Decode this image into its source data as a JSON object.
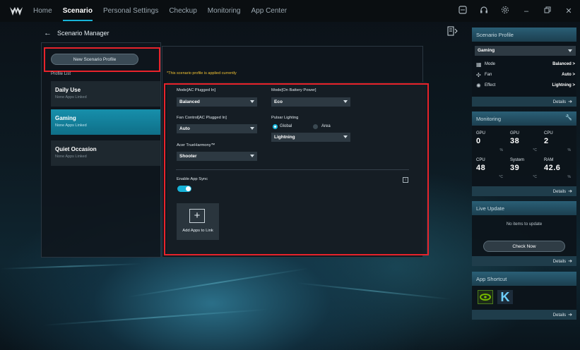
{
  "topbar": {
    "tabs": [
      {
        "label": "Home",
        "active": false
      },
      {
        "label": "Scenario",
        "active": true
      },
      {
        "label": "Personal Settings",
        "active": false
      },
      {
        "label": "Checkup",
        "active": false
      },
      {
        "label": "Monitoring",
        "active": false
      },
      {
        "label": "App Center",
        "active": false
      }
    ],
    "icons": [
      "screenshot-icon",
      "headset-icon",
      "settings-gear-icon",
      "minimize-icon",
      "restore-icon",
      "close-icon"
    ]
  },
  "header": {
    "title": "Scenario Manager"
  },
  "left": {
    "new_button": "New Scenario Profile",
    "list_label": "Profile List",
    "profiles": [
      {
        "name": "Daily Use",
        "sub": "None Apps Linked"
      },
      {
        "name": "Gaming",
        "sub": "None Apps Linked"
      },
      {
        "name": "Quiet Occasion",
        "sub": "None Apps Linked"
      }
    ]
  },
  "main": {
    "applied_note": "*This scenario profile is applied currently",
    "mode_ac_label": "Mode[AC Plugged In]",
    "mode_ac_value": "Balanced",
    "mode_battery_label": "Mode[On Battery Power]",
    "mode_battery_value": "Eco",
    "fan_label": "Fan Control[AC Plugged In]",
    "fan_value": "Auto",
    "pulsar_label": "Pulsar Lighting",
    "radio_global": "Global",
    "radio_area": "Area",
    "lighting_value": "Lightning",
    "trueharmony_label": "Acer TrueHarmony™",
    "trueharmony_value": "Shooter",
    "app_sync_label": "Enable App Sync",
    "add_apps_label": "Add Apps to Link"
  },
  "sidebar": {
    "scenario_profile": {
      "title": "Scenario Profile",
      "selected": "Gaming",
      "rows": [
        {
          "icon": "mode-icon",
          "key": "Mode",
          "value": "Balanced >"
        },
        {
          "icon": "fan-icon",
          "key": "Fan",
          "value": "Auto >"
        },
        {
          "icon": "effect-icon",
          "key": "Effect",
          "value": "Lightning >"
        }
      ],
      "details": "Details"
    },
    "monitoring": {
      "title": "Monitoring",
      "cells": [
        {
          "label": "GPU",
          "value": "0",
          "unit": "%"
        },
        {
          "label": "GPU",
          "value": "38",
          "unit": "°C"
        },
        {
          "label": "CPU",
          "value": "2",
          "unit": "%"
        },
        {
          "label": "CPU",
          "value": "48",
          "unit": "°C"
        },
        {
          "label": "System",
          "value": "39",
          "unit": "°C"
        },
        {
          "label": "RAM",
          "value": "42.6",
          "unit": "%"
        }
      ],
      "details": "Details"
    },
    "live_update": {
      "title": "Live Update",
      "no_items": "No items to update",
      "check_button": "Check Now",
      "details": "Details"
    },
    "app_shortcut": {
      "title": "App Shortcut",
      "apps": [
        {
          "icon": "nvidia-icon"
        },
        {
          "icon": "k-app-icon"
        }
      ],
      "details": "Details"
    }
  }
}
